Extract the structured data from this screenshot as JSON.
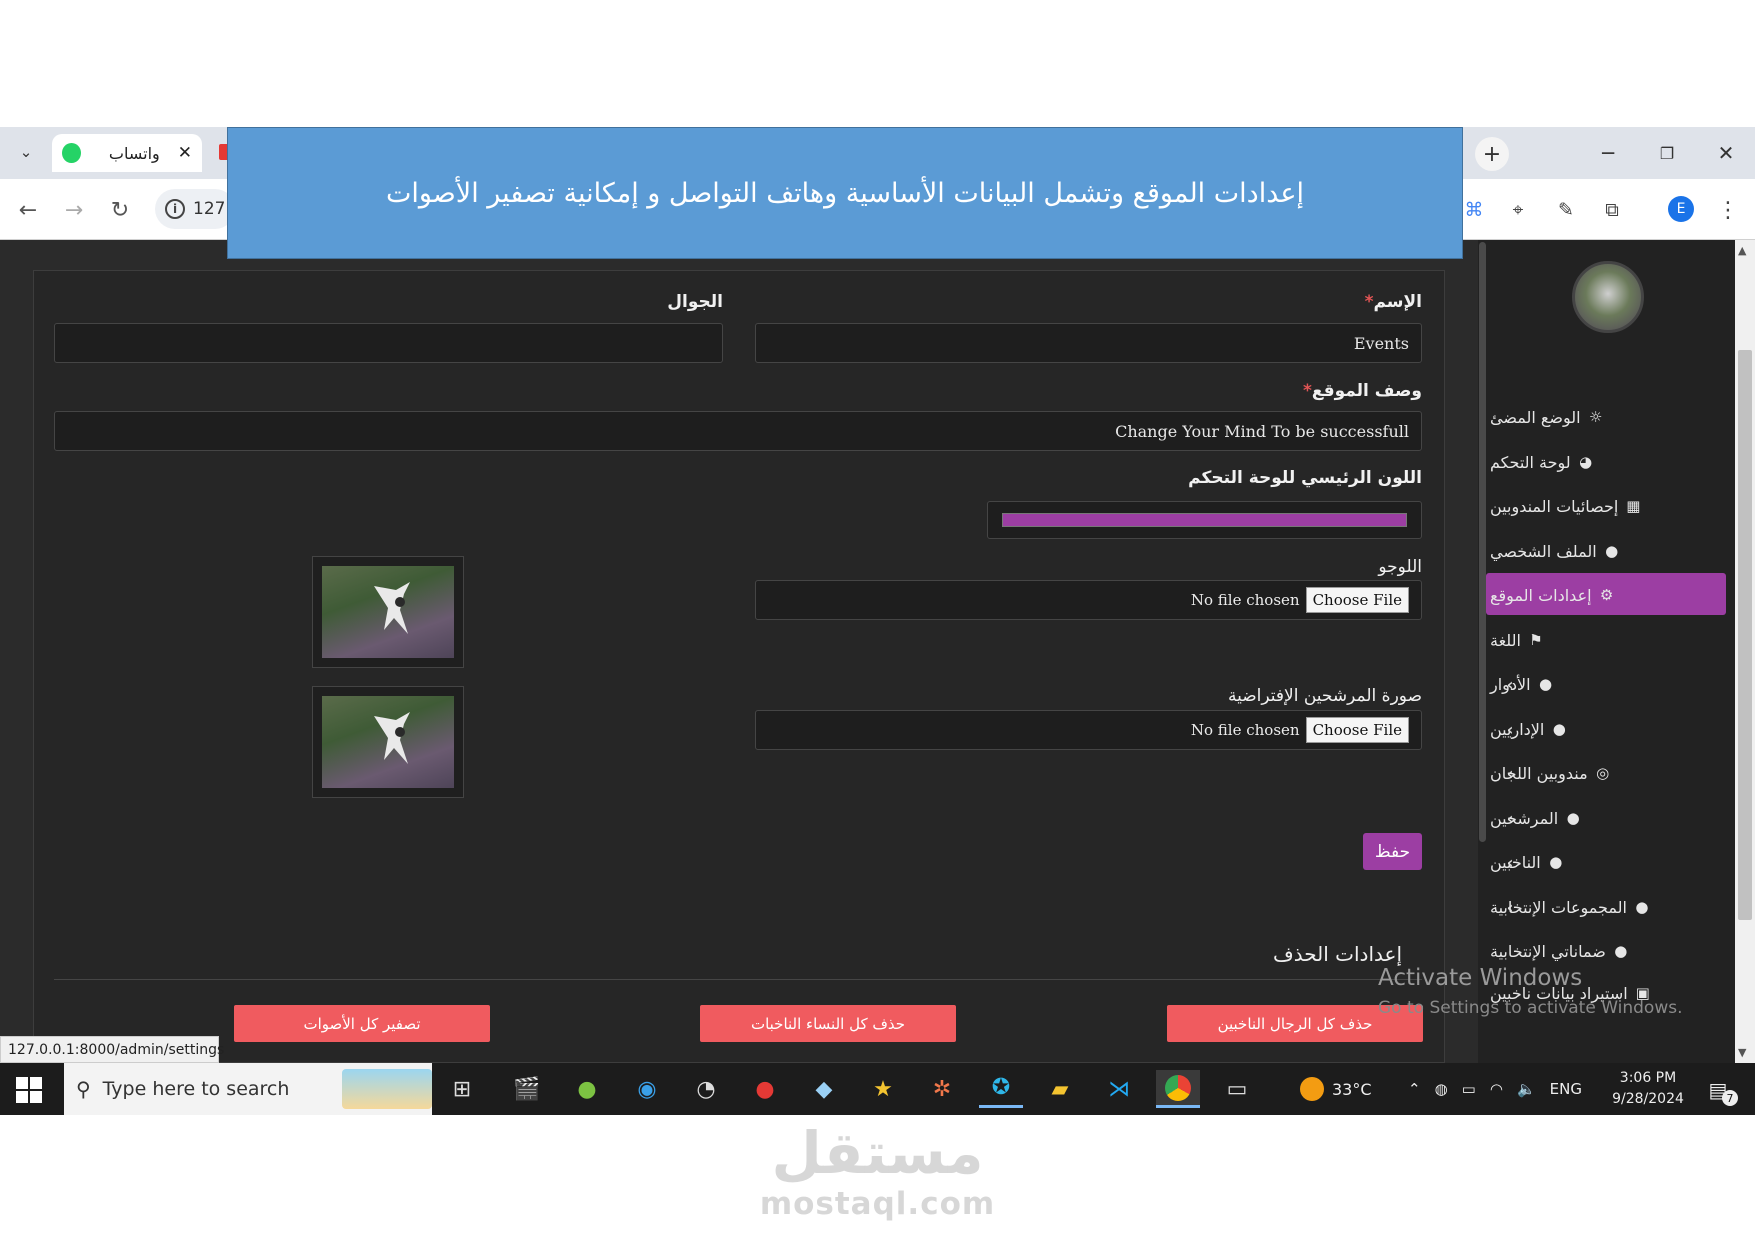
{
  "banner": {
    "text": "إعدادات الموقع وتشمل البيانات الأساسية وهاتف التواصل و إمكانية تصفير الأصوات"
  },
  "browser": {
    "tab_label": "واتساب",
    "address_text": "127",
    "status_url": "127.0.0.1:8000/admin/settings",
    "profile_initial": "E"
  },
  "form": {
    "name_label": "الإسم",
    "name_required": "*",
    "name_value": "Events",
    "mobile_label": "الجوال",
    "mobile_value": "",
    "desc_label": "وصف الموقع",
    "desc_required": "*",
    "desc_value": "Change Your Mind To be successfull",
    "color_label": "اللون الرئيسي للوحة التحكم",
    "color_value": "#9c3ea3",
    "logo_label": "اللوجو",
    "choose_file": "Choose File",
    "no_file": "No file chosen",
    "candidate_label": "صورة المرشحين الإفتراضية",
    "save_label": "حفظ",
    "delete_settings_title": "إعدادات الحذف"
  },
  "delete_buttons": {
    "delete_men": "حذف كل الرجال الناخبين",
    "delete_women": "حذف كل النساء الناخبات",
    "reset_votes": "تصفير كل الأصوات"
  },
  "sidebar": {
    "items": [
      {
        "label": "الوضع المضئ",
        "icon": "sun-icon"
      },
      {
        "label": "لوحة التحكم",
        "icon": "dashboard-icon"
      },
      {
        "label": "إحصائيات المندوبين",
        "icon": "chart-icon"
      },
      {
        "label": "الملف الشخصي",
        "icon": "user-icon"
      },
      {
        "label": "إعدادات الموقع",
        "icon": "gears-icon",
        "active": true
      },
      {
        "label": "اللغة",
        "icon": "flag-icon"
      },
      {
        "label": "الأدوار",
        "icon": "user-lock-icon",
        "chevron": true
      },
      {
        "label": "الإداريين",
        "icon": "user-tie-icon",
        "chevron": true
      },
      {
        "label": "مندوبين اللجان",
        "icon": "user-circle-icon",
        "chevron": true
      },
      {
        "label": "المرشحين",
        "icon": "user-secret-icon",
        "chevron": true
      },
      {
        "label": "الناخبين",
        "icon": "user-plus-icon",
        "chevron": true
      },
      {
        "label": "المجموعات الإنتخابية",
        "icon": "users-icon",
        "chevron": true
      },
      {
        "label": "ضماناتي الإنتخابية",
        "icon": "user-check-icon"
      },
      {
        "label": "استيراد بيانات ناخبين",
        "icon": "file-import-icon"
      }
    ]
  },
  "windows": {
    "activate_title": "Activate Windows",
    "activate_sub": "Go to Settings to activate Windows.",
    "search_placeholder": "Type here to search",
    "temperature": "33°C",
    "language": "ENG",
    "time": "3:06 PM",
    "date": "9/28/2024",
    "notif_count": "7"
  },
  "watermark": {
    "arabic": "مستقل",
    "latin": "mostaql.com"
  },
  "colors": {
    "accent": "#9c3ea3",
    "danger": "#f05b5f",
    "banner": "#5b9bd5"
  }
}
